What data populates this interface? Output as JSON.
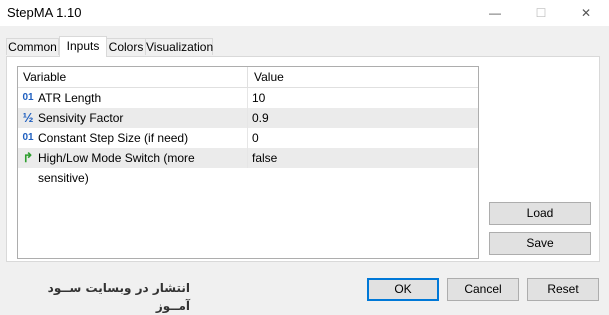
{
  "window": {
    "title": "StepMA 1.10",
    "minimize_glyph": "—",
    "maximize_glyph": "☐",
    "close_glyph": "✕"
  },
  "tabs": [
    {
      "label": "Common",
      "active": false
    },
    {
      "label": "Inputs",
      "active": true
    },
    {
      "label": "Colors",
      "active": false
    },
    {
      "label": "Visualization",
      "active": false
    }
  ],
  "table": {
    "headers": {
      "variable": "Variable",
      "value": "Value"
    },
    "rows": [
      {
        "icon": "int-type-icon",
        "icon_glyph": "01",
        "variable": "ATR Length",
        "value": "10"
      },
      {
        "icon": "double-type-icon",
        "icon_glyph": "½",
        "variable": "Sensivity Factor",
        "value": "0.9"
      },
      {
        "icon": "int-type-icon",
        "icon_glyph": "01",
        "variable": "Constant Step Size (if need)",
        "value": "0"
      },
      {
        "icon": "bool-type-icon",
        "icon_glyph": "↱",
        "variable": "High/Low Mode Switch (more sensitive)",
        "value": "false"
      }
    ]
  },
  "side_buttons": {
    "load": "Load",
    "save": "Save"
  },
  "footer": {
    "watermark": "انتشار در وبسایت  ســود آمــوز",
    "ok": "OK",
    "cancel": "Cancel",
    "reset": "Reset"
  },
  "colors": {
    "accent": "#0078d7",
    "icon_blue": "#1f5fbf",
    "icon_green": "#2e9e2e"
  }
}
